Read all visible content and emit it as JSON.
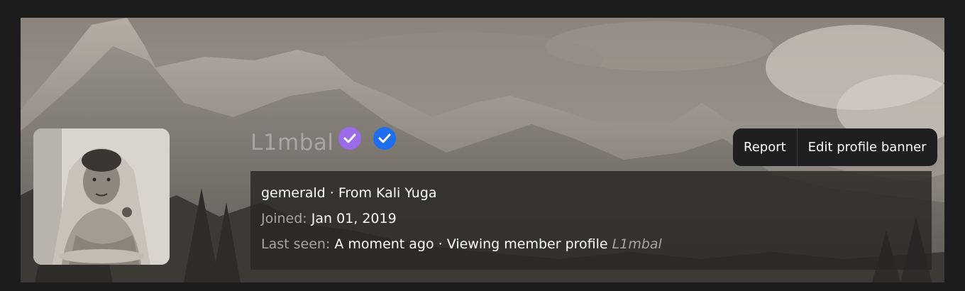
{
  "profile": {
    "username": "L1mbal",
    "badges": [
      {
        "icon": "check-badge-purple-icon",
        "color": "#9b6bea"
      },
      {
        "icon": "check-badge-blue-icon",
        "color": "#1e6ff0"
      }
    ]
  },
  "actions": {
    "report_label": "Report",
    "edit_banner_label": "Edit profile banner"
  },
  "info": {
    "handle": "gemerald",
    "separator": " · ",
    "location": "From Kali Yuga",
    "joined_label": "Joined:",
    "joined_value": "Jan 01, 2019",
    "last_seen_label": "Last seen:",
    "last_seen_value": "A moment ago",
    "activity": "Viewing member profile",
    "activity_target": "L1mbal"
  },
  "colors": {
    "page_bg": "#1c1c1c",
    "buttons_bg": "#1f1f22",
    "info_panel_bg": "#282624",
    "muted_text": "#a8a5a1"
  }
}
